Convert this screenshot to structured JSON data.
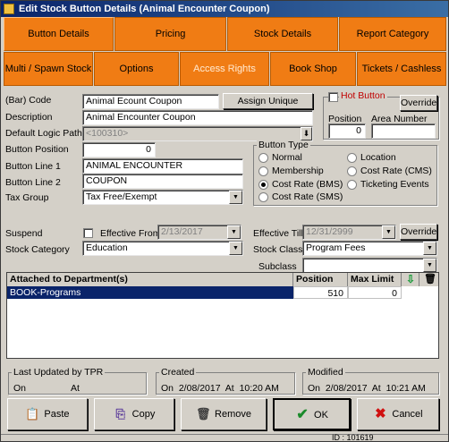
{
  "window": {
    "title": "Edit Stock Button Details (Animal Encounter Coupon)"
  },
  "tabs_row1": [
    {
      "label": "Button Details"
    },
    {
      "label": "Pricing"
    },
    {
      "label": "Stock Details"
    },
    {
      "label": "Report Category"
    }
  ],
  "tabs_row2": [
    {
      "label": "Multi / Spawn Stock"
    },
    {
      "label": "Options"
    },
    {
      "label": "Access Rights"
    },
    {
      "label": "Book Shop"
    },
    {
      "label": "Tickets / Cashless"
    }
  ],
  "form": {
    "barcode_label": "(Bar) Code",
    "barcode_value": "Animal Ecount Coupon",
    "assign_barcode_button": "Assign Unique Barcode",
    "description_label": "Description",
    "description_value": "Animal Encounter Coupon",
    "logic_path_label": "Default Logic Path",
    "logic_path_value": "<100310>",
    "position_label": "Button Position",
    "position_value": "0",
    "line1_label": "Button Line 1",
    "line1_value": "ANIMAL ENCOUNTER",
    "line2_label": "Button Line 2",
    "line2_value": "COUPON",
    "tax_label": "Tax Group",
    "tax_value": "Tax Free/Exempt",
    "hot_button_label": "Hot Button",
    "override_label": "Override",
    "hot_position_label": "Position",
    "hot_position_value": "0",
    "area_number_label": "Area Number",
    "area_number_value": ""
  },
  "button_type": {
    "title": "Button Type",
    "options": [
      "Normal",
      "Location",
      "Membership",
      "Cost Rate (CMS)",
      "Cost Rate (BMS)",
      "Ticketing Events",
      "Cost Rate (SMS)"
    ],
    "selected": "Cost Rate (BMS)"
  },
  "suspend": {
    "suspend_label": "Suspend",
    "effective_from_label": "Effective From",
    "effective_from_value": "2/13/2017",
    "effective_till_label": "Effective Till",
    "effective_till_value": "12/31/2999",
    "override_label": "Override",
    "stock_category_label": "Stock Category",
    "stock_category_value": "Education",
    "stock_class_label": "Stock Class",
    "stock_class_value": "Program Fees",
    "subclass_label": "Subclass",
    "subclass_value": ""
  },
  "departments": {
    "columns": [
      "Attached to Department(s)",
      "Position",
      "Max Limit"
    ],
    "rows": [
      {
        "name": "BOOK-Programs",
        "position": "510",
        "max_limit": "0"
      }
    ]
  },
  "footer": {
    "updated_title": "Last Updated by TPR",
    "updated_on": "On",
    "updated_at": "At",
    "created_title": "Created",
    "created_text": "On  2/08/2017  At  10:20 AM",
    "modified_title": "Modified",
    "modified_text": "On  2/08/2017  At  10:21 AM"
  },
  "buttons": {
    "paste": "Paste",
    "copy": "Copy",
    "remove": "Remove",
    "ok": "OK",
    "cancel": "Cancel"
  },
  "status": {
    "id_text": "ID : 101619"
  },
  "colors": {
    "tab": "#f07c14",
    "titlebar": "#0a246a",
    "selection": "#0a246a"
  }
}
